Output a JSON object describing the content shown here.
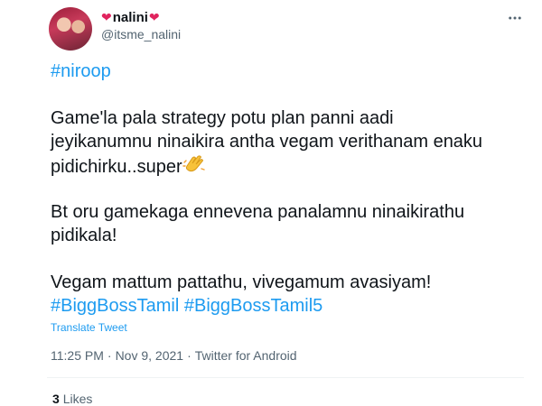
{
  "author": {
    "display_name": "nalini",
    "handle": "@itsme_nalini",
    "name_decoration_icon": "red-heart-emoji"
  },
  "tweet": {
    "hashtag_top": "#niroop",
    "line1": "Game'la pala strategy potu plan panni aadi",
    "line2": "jeyikanumnu ninaikira antha vegam verithanam enaku",
    "line3": "pidichirku..super",
    "line3_emoji": "clapping-hands-emoji",
    "line4": "Bt oru gamekaga ennevena panalamnu ninaikirathu",
    "line5": "pidikala!",
    "line6": "Vegam mattum pattathu, vivegamum avasiyam!",
    "hashtag_1": "#BiggBossTamil",
    "hashtag_2": "#BiggBossTamil5"
  },
  "translate_label": "Translate Tweet",
  "meta": {
    "time": "11:25 PM",
    "separator": "·",
    "date": "Nov 9, 2021",
    "source": "Twitter for Android"
  },
  "engagement": {
    "likes_count": "3",
    "likes_label": "Likes"
  },
  "colors": {
    "link": "#1d9bf0",
    "text": "#0f1419",
    "secondary": "#536471",
    "heart": "#e0245e"
  }
}
